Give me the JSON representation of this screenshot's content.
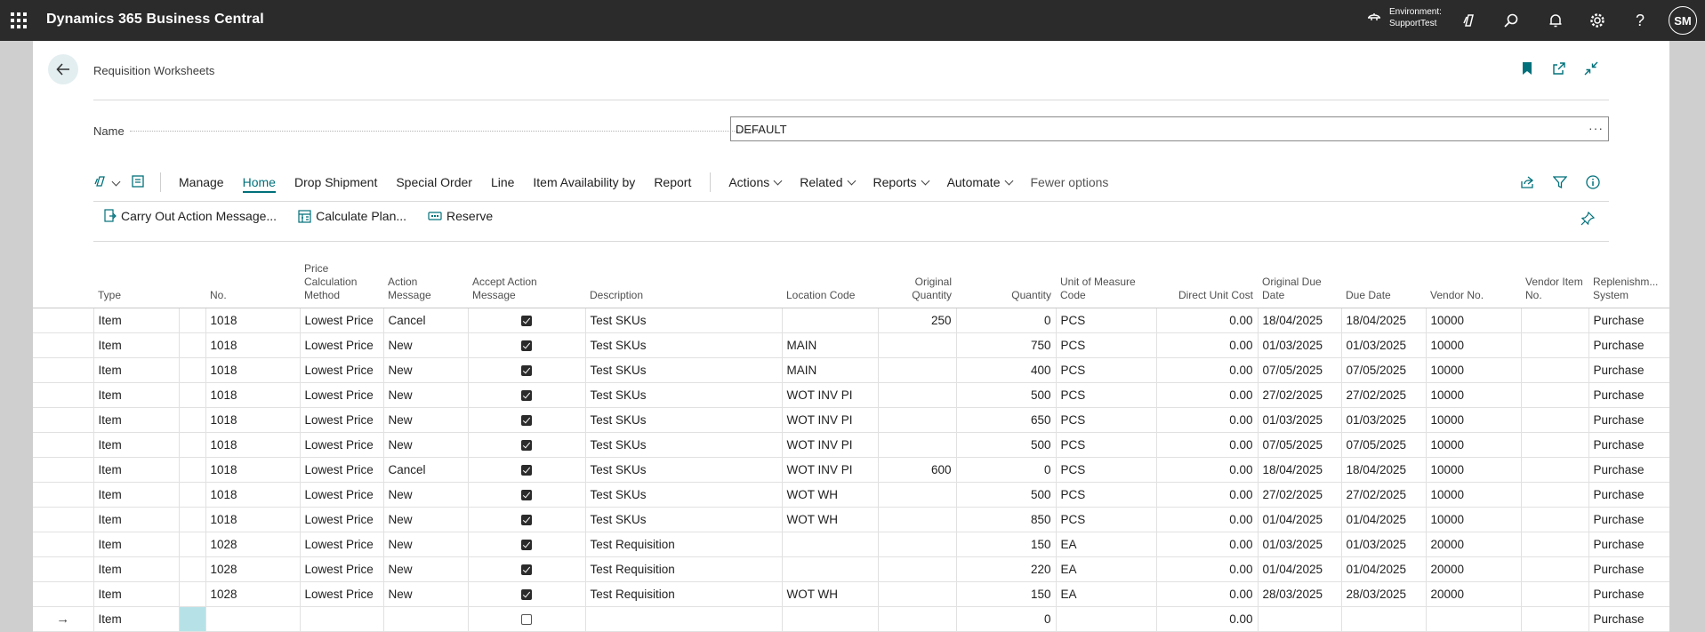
{
  "app": {
    "title": "Dynamics 365 Business Central",
    "environment_label": "Environment:",
    "environment_name": "SupportTest",
    "avatar_initials": "SM"
  },
  "page": {
    "caption": "Requisition Worksheets",
    "name_label": "Name",
    "name_value": "DEFAULT",
    "name_more": "···"
  },
  "actionbar": {
    "items": [
      "Manage",
      "Home",
      "Drop Shipment",
      "Special Order",
      "Line",
      "Item Availability by",
      "Report"
    ],
    "active": "Home",
    "menus": [
      "Actions",
      "Related",
      "Reports",
      "Automate"
    ],
    "fewer_options": "Fewer options"
  },
  "promoted": [
    "Carry Out Action Message...",
    "Calculate Plan...",
    "Reserve"
  ],
  "columns": [
    "Type",
    "No.",
    "Price Calculation Method",
    "Action Message",
    "Accept Action Message",
    "Description",
    "Location Code",
    "Original Quantity",
    "Quantity",
    "Unit of Measure Code",
    "Direct Unit Cost",
    "Original Due Date",
    "Due Date",
    "Vendor No.",
    "Vendor Item No.",
    "Replenishm... System"
  ],
  "rows": [
    {
      "type": "Item",
      "no": "1018",
      "pcm": "Lowest Price",
      "action": "Cancel",
      "accept": true,
      "desc": "Test SKUs",
      "loc": "",
      "orig_qty": "250",
      "qty": "0",
      "uom": "PCS",
      "cost": "0.00",
      "orig_due": "18/04/2025",
      "due": "18/04/2025",
      "vendor": "10000",
      "vendor_item": "",
      "repl": "Purchase"
    },
    {
      "type": "Item",
      "no": "1018",
      "pcm": "Lowest Price",
      "action": "New",
      "accept": true,
      "desc": "Test SKUs",
      "loc": "MAIN",
      "orig_qty": "",
      "qty": "750",
      "uom": "PCS",
      "cost": "0.00",
      "orig_due": "01/03/2025",
      "due": "01/03/2025",
      "vendor": "10000",
      "vendor_item": "",
      "repl": "Purchase"
    },
    {
      "type": "Item",
      "no": "1018",
      "pcm": "Lowest Price",
      "action": "New",
      "accept": true,
      "desc": "Test SKUs",
      "loc": "MAIN",
      "orig_qty": "",
      "qty": "400",
      "uom": "PCS",
      "cost": "0.00",
      "orig_due": "07/05/2025",
      "due": "07/05/2025",
      "vendor": "10000",
      "vendor_item": "",
      "repl": "Purchase"
    },
    {
      "type": "Item",
      "no": "1018",
      "pcm": "Lowest Price",
      "action": "New",
      "accept": true,
      "desc": "Test SKUs",
      "loc": "WOT INV PI",
      "orig_qty": "",
      "qty": "500",
      "uom": "PCS",
      "cost": "0.00",
      "orig_due": "27/02/2025",
      "due": "27/02/2025",
      "vendor": "10000",
      "vendor_item": "",
      "repl": "Purchase"
    },
    {
      "type": "Item",
      "no": "1018",
      "pcm": "Lowest Price",
      "action": "New",
      "accept": true,
      "desc": "Test SKUs",
      "loc": "WOT INV PI",
      "orig_qty": "",
      "qty": "650",
      "uom": "PCS",
      "cost": "0.00",
      "orig_due": "01/03/2025",
      "due": "01/03/2025",
      "vendor": "10000",
      "vendor_item": "",
      "repl": "Purchase"
    },
    {
      "type": "Item",
      "no": "1018",
      "pcm": "Lowest Price",
      "action": "New",
      "accept": true,
      "desc": "Test SKUs",
      "loc": "WOT INV PI",
      "orig_qty": "",
      "qty": "500",
      "uom": "PCS",
      "cost": "0.00",
      "orig_due": "07/05/2025",
      "due": "07/05/2025",
      "vendor": "10000",
      "vendor_item": "",
      "repl": "Purchase"
    },
    {
      "type": "Item",
      "no": "1018",
      "pcm": "Lowest Price",
      "action": "Cancel",
      "accept": true,
      "desc": "Test SKUs",
      "loc": "WOT INV PI",
      "orig_qty": "600",
      "qty": "0",
      "uom": "PCS",
      "cost": "0.00",
      "orig_due": "18/04/2025",
      "due": "18/04/2025",
      "vendor": "10000",
      "vendor_item": "",
      "repl": "Purchase"
    },
    {
      "type": "Item",
      "no": "1018",
      "pcm": "Lowest Price",
      "action": "New",
      "accept": true,
      "desc": "Test SKUs",
      "loc": "WOT WH",
      "orig_qty": "",
      "qty": "500",
      "uom": "PCS",
      "cost": "0.00",
      "orig_due": "27/02/2025",
      "due": "27/02/2025",
      "vendor": "10000",
      "vendor_item": "",
      "repl": "Purchase"
    },
    {
      "type": "Item",
      "no": "1018",
      "pcm": "Lowest Price",
      "action": "New",
      "accept": true,
      "desc": "Test SKUs",
      "loc": "WOT WH",
      "orig_qty": "",
      "qty": "850",
      "uom": "PCS",
      "cost": "0.00",
      "orig_due": "01/04/2025",
      "due": "01/04/2025",
      "vendor": "10000",
      "vendor_item": "",
      "repl": "Purchase"
    },
    {
      "type": "Item",
      "no": "1028",
      "pcm": "Lowest Price",
      "action": "New",
      "accept": true,
      "desc": "Test Requisition",
      "loc": "",
      "orig_qty": "",
      "qty": "150",
      "uom": "EA",
      "cost": "0.00",
      "orig_due": "01/03/2025",
      "due": "01/03/2025",
      "vendor": "20000",
      "vendor_item": "",
      "repl": "Purchase"
    },
    {
      "type": "Item",
      "no": "1028",
      "pcm": "Lowest Price",
      "action": "New",
      "accept": true,
      "desc": "Test Requisition",
      "loc": "",
      "orig_qty": "",
      "qty": "220",
      "uom": "EA",
      "cost": "0.00",
      "orig_due": "01/04/2025",
      "due": "01/04/2025",
      "vendor": "20000",
      "vendor_item": "",
      "repl": "Purchase"
    },
    {
      "type": "Item",
      "no": "1028",
      "pcm": "Lowest Price",
      "action": "New",
      "accept": true,
      "desc": "Test Requisition",
      "loc": "WOT WH",
      "orig_qty": "",
      "qty": "150",
      "uom": "EA",
      "cost": "0.00",
      "orig_due": "28/03/2025",
      "due": "28/03/2025",
      "vendor": "20000",
      "vendor_item": "",
      "repl": "Purchase"
    }
  ],
  "new_row": {
    "marker": "→",
    "type": "Item",
    "accept": false,
    "qty": "0",
    "cost": "0.00",
    "repl": "Purchase"
  },
  "colors": {
    "accent": "#00707a",
    "topbar": "#2b2b2b",
    "selection": "#b6e2e7"
  }
}
